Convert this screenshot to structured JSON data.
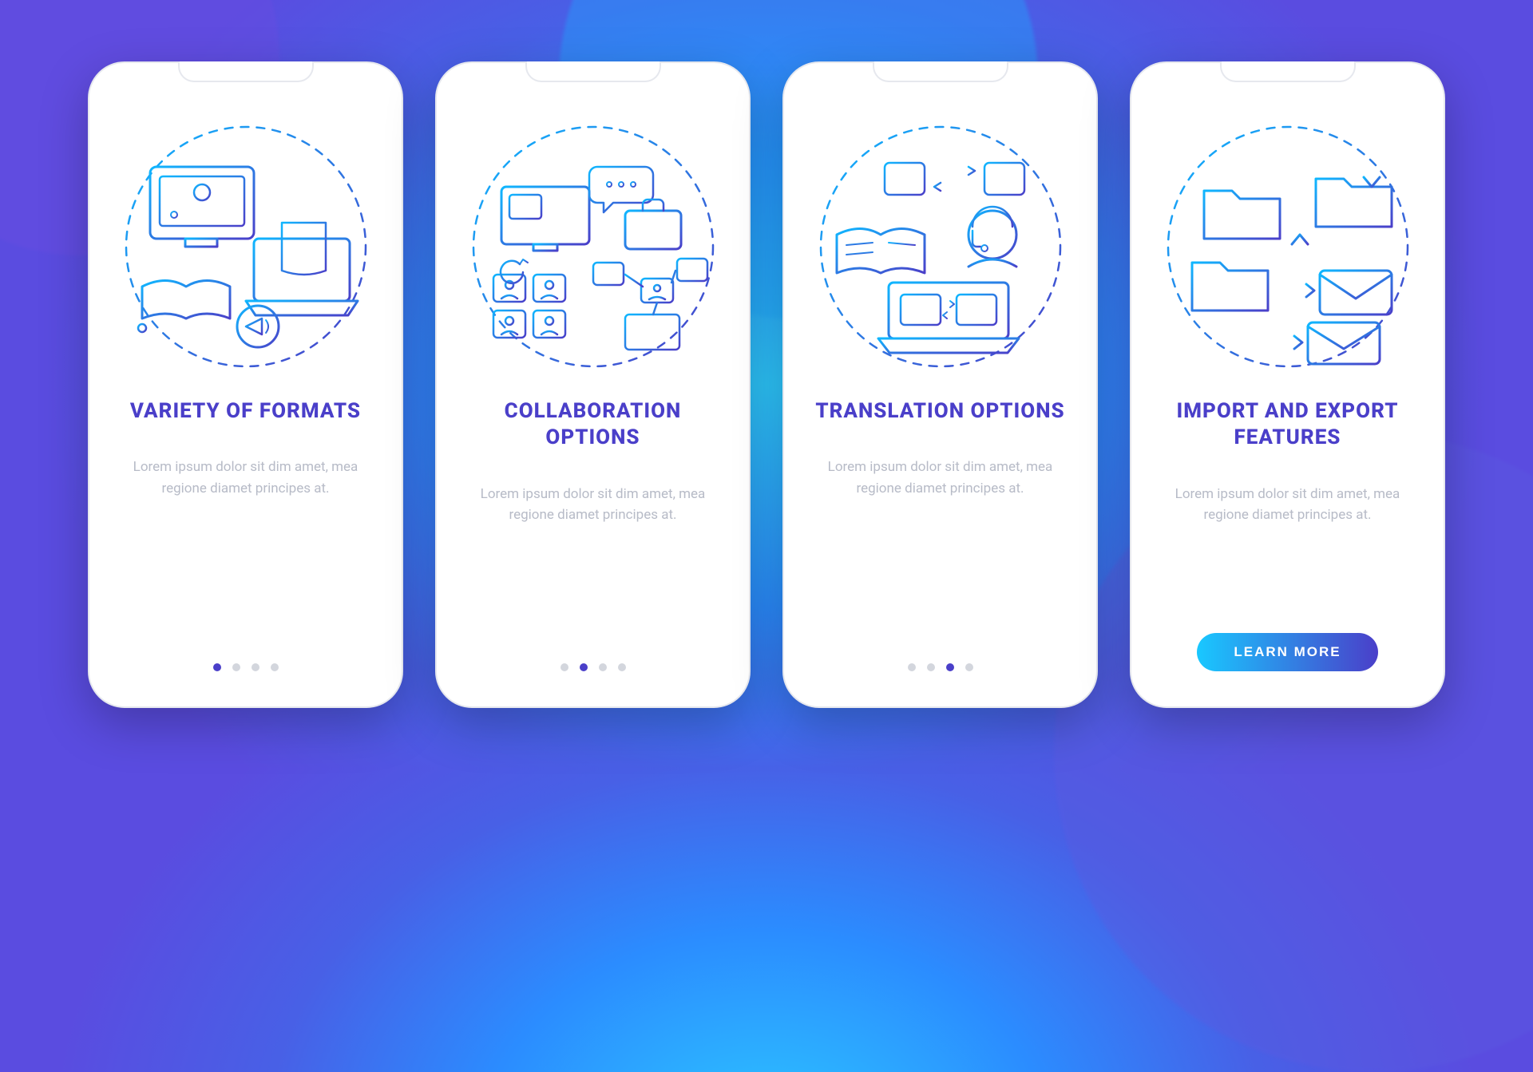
{
  "screens": [
    {
      "title": "VARIETY OF FORMATS",
      "description": "Lorem ipsum dolor sit dim amet, mea regione diamet principes at.",
      "iconName": "formats-illustration",
      "activeDot": 0,
      "hasCta": false
    },
    {
      "title": "COLLABORATION OPTIONS",
      "description": "Lorem ipsum dolor sit dim amet, mea regione diamet principes at.",
      "iconName": "collaboration-illustration",
      "activeDot": 1,
      "hasCta": false
    },
    {
      "title": "TRANSLATION OPTIONS",
      "description": "Lorem ipsum dolor sit dim amet, mea regione diamet principes at.",
      "iconName": "translation-illustration",
      "activeDot": 2,
      "hasCta": false
    },
    {
      "title": "IMPORT AND EXPORT FEATURES",
      "description": "Lorem ipsum dolor sit dim amet, mea regione diamet principes at.",
      "iconName": "import-export-illustration",
      "activeDot": 3,
      "hasCta": true
    }
  ],
  "totalDots": 4,
  "ctaLabel": "LEARN MORE",
  "colors": {
    "accent": "#4a3fc9",
    "gradientStart": "#19c8ff",
    "gradientEnd": "#4a3fc9"
  }
}
